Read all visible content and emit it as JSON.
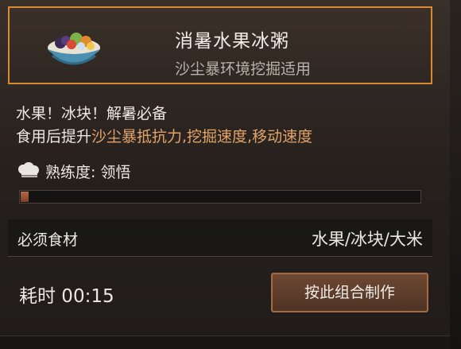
{
  "recipe": {
    "title": "消暑水果冰粥",
    "subtitle": "沙尘暴环境挖掘适用",
    "icon": "fruit-ice-porridge-bowl-icon"
  },
  "description": {
    "line1": "水果！冰块！解暑必备",
    "line2_prefix": "食用后提升",
    "line2_highlight": "沙尘暴抵抗力,挖掘速度,移动速度",
    "highlight_color": "#e3a46a"
  },
  "proficiency": {
    "icon": "chef-hat-icon",
    "text": "熟练度: 领悟",
    "progress": 0.02
  },
  "ingredients": {
    "label": "必须食材",
    "value": "水果/冰块/大米"
  },
  "craft": {
    "time_text": "耗时 00:15",
    "button_label": "按此组合制作",
    "accent_color": "#d9892f"
  }
}
